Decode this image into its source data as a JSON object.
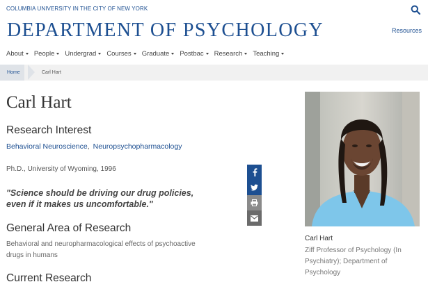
{
  "header": {
    "university": "COLUMBIA UNIVERSITY IN THE CITY OF NEW YORK",
    "department": "DEPARTMENT OF PSYCHOLOGY",
    "resources": "Resources",
    "search_icon": "search-icon"
  },
  "nav": {
    "items": [
      {
        "label": "About"
      },
      {
        "label": "People"
      },
      {
        "label": "Undergrad"
      },
      {
        "label": "Courses"
      },
      {
        "label": "Graduate"
      },
      {
        "label": "Postbac"
      },
      {
        "label": "Research"
      },
      {
        "label": "Teaching"
      }
    ]
  },
  "breadcrumb": {
    "home": "Home",
    "current": "Carl Hart"
  },
  "profile": {
    "name": "Carl Hart",
    "research_interest_title": "Research Interest",
    "interests": [
      "Behavioral Neuroscience",
      "Neuropsychopharmacology"
    ],
    "interest_separator": ",",
    "degree": "Ph.D., University of Wyoming, 1996",
    "quote_line1": "\"Science should be driving our drug policies,",
    "quote_line2": "even if it makes us uncomfortable.\"",
    "general_area_title": "General Area of Research",
    "general_area_line1": "Behavioral and neuropharmacological effects of psychoactive",
    "general_area_line2": "drugs in humans",
    "current_research_title": "Current Research"
  },
  "photo_caption": {
    "name": "Carl Hart",
    "title_line1": "Ziff Professor of Psychology (In",
    "title_line2": "Psychiatry); Department of",
    "title_line3": "Psychology"
  },
  "share": {
    "icons": [
      "facebook-icon",
      "twitter-icon",
      "print-icon",
      "email-icon"
    ]
  },
  "colors": {
    "brand_blue": "#1d4f91",
    "breadcrumb_bg": "#f1f1f1",
    "shirt_blue": "#7ec6ea"
  }
}
